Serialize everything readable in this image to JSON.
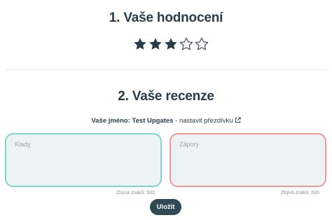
{
  "rating_section": {
    "title": "1. Vaše hodnocení",
    "rating": 3,
    "max_rating": 5
  },
  "review_section": {
    "title": "2. Vaše recenze",
    "name_label": "Vaše jméno:",
    "name_value": "Test Upgates",
    "separator": " - ",
    "nickname_link": "nastavit přezdívku",
    "pros": {
      "placeholder": "Klady",
      "value": "",
      "counter_text": "Zbývá znaků: 500"
    },
    "cons": {
      "placeholder": "Zápory",
      "value": "",
      "counter_text": "Zbývá znaků: 500"
    },
    "save_label": "Uložit"
  },
  "colors": {
    "star_filled": "#263c47",
    "star_empty_stroke": "#263c47",
    "pros_border": "#7fd6cc",
    "cons_border": "#ef9a9a",
    "button_bg": "#2f4a55"
  },
  "icons": {
    "star": "star-icon",
    "external_link": "external-link-icon"
  }
}
